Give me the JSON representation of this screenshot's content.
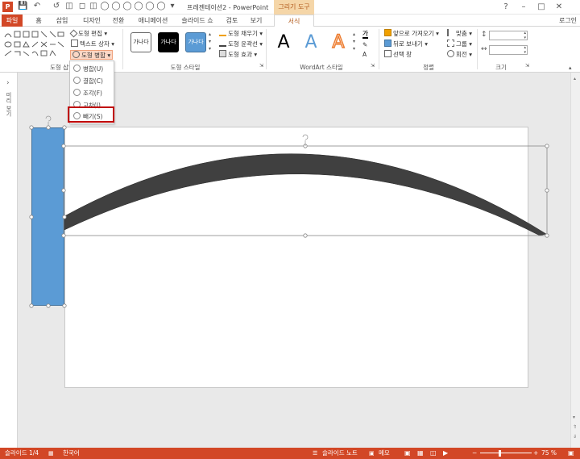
{
  "window": {
    "app_icon": "P",
    "title": "프레젠테이션2 - PowerPoint",
    "context_title": "그리기 도구",
    "account": "로그인",
    "controls": [
      "?",
      "–",
      "□",
      "✕"
    ]
  },
  "quick_access": [
    "save-icon",
    "undo-icon",
    "redo-icon",
    "shape-icon",
    "shape-icon",
    "shape-icon",
    "shape-icon",
    "shape-icon",
    "shape-icon",
    "shape-icon"
  ],
  "tabs": {
    "file": "파일",
    "home": "홈",
    "insert": "삽입",
    "design": "디자인",
    "transitions": "전환",
    "animations": "애니메이션",
    "slideshow": "슬라이드 쇼",
    "review": "검토",
    "view": "보기",
    "format": "서식"
  },
  "ribbon": {
    "insert_shapes": {
      "label": "도형 삽입",
      "edit_shape": "도형 편집",
      "text_box": "텍스트 상자",
      "merge_shapes": "도형 병합"
    },
    "shape_styles": {
      "label": "도형 스타일",
      "preset1": "가나다",
      "preset2": "가나다",
      "preset3": "가나다",
      "fill": "도형 채우기",
      "outline": "도형 윤곽선",
      "effects": "도형 효과"
    },
    "wordart": {
      "label": "WordArt 스타일",
      "sample": "A",
      "text_fill_icon": "가"
    },
    "arrange": {
      "label": "정렬",
      "bring_forward": "앞으로 가져오기",
      "send_backward": "뒤로 보내기",
      "selection_pane": "선택 창",
      "align": "맞춤",
      "group": "그룹",
      "rotate": "회전"
    },
    "size": {
      "label": "크기",
      "height": "",
      "width": ""
    }
  },
  "merge_menu": {
    "items": [
      {
        "label": "병합(U)",
        "icon": "union-icon"
      },
      {
        "label": "결합(C)",
        "icon": "combine-icon"
      },
      {
        "label": "조각(F)",
        "icon": "fragment-icon"
      },
      {
        "label": "교차(I)",
        "icon": "intersect-icon"
      },
      {
        "label": "빼기(S)",
        "icon": "subtract-icon"
      }
    ],
    "highlighted": "빼기(S)"
  },
  "thumbnails_pane": {
    "collapse_glyph": "›",
    "label": "미리 보기"
  },
  "status": {
    "slide": "슬라이드 1/4",
    "language": "한국어",
    "notes": "슬라이드 노트",
    "comments": "메모",
    "zoom": "75 %"
  },
  "colors": {
    "accent": "#d24726",
    "rect_fill": "#5b9bd5",
    "arc_fill": "#404040",
    "highlight_box": "#c00000"
  }
}
